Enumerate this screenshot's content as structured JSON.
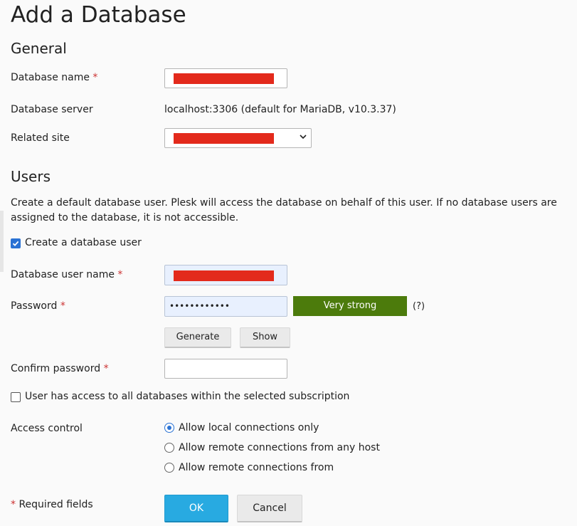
{
  "page_title": "Add a Database",
  "required_mark": "*",
  "general": {
    "heading": "General",
    "db_name_label": "Database name",
    "db_server_label": "Database server",
    "db_server_value": "localhost:3306 (default for MariaDB, v10.3.37)",
    "related_site_label": "Related site"
  },
  "users": {
    "heading": "Users",
    "description": "Create a default database user. Plesk will access the database on behalf of this user. If no database users are assigned to the database, it is not accessible.",
    "create_user_label": "Create a database user",
    "create_user_checked": true,
    "user_name_label": "Database user name",
    "password_label": "Password",
    "password_value": "••••••••••••",
    "strength_label": "Very strong",
    "strength_help": "(?)",
    "generate_label": "Generate",
    "show_label": "Show",
    "confirm_label": "Confirm password",
    "all_access_label": "User has access to all databases within the selected subscription",
    "all_access_checked": false,
    "access_control_label": "Access control",
    "access_options": [
      "Allow local connections only",
      "Allow remote connections from any host",
      "Allow remote connections from"
    ],
    "access_selected_index": 0
  },
  "footer": {
    "required_fields_label": "Required fields",
    "ok_label": "OK",
    "cancel_label": "Cancel"
  },
  "colors": {
    "accent": "#28aae1",
    "strength": "#4c7b0c",
    "required": "#cc3333",
    "redaction": "#e32a1c"
  }
}
